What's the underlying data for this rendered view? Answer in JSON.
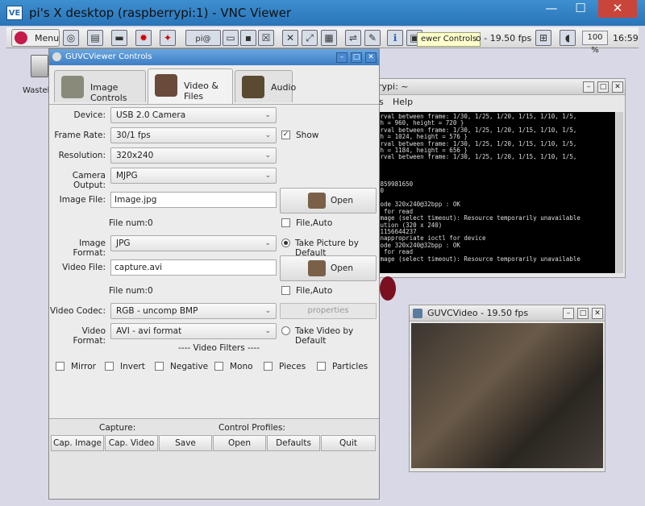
{
  "window": {
    "title": "pi's X desktop (raspberrypi:1) - VNC Viewer",
    "minimize": "—",
    "maximize": "☐",
    "close": "✕"
  },
  "panel": {
    "menu_label": "Menu",
    "tooltip": "ewer Controls",
    "fps_text": "o - 19.50 fps",
    "zoom": "100 %",
    "clock": "16:59",
    "task_label": "pi@"
  },
  "desktop": {
    "trash_label": "Wasteb"
  },
  "terminal": {
    "title": "rypi: ~",
    "menu": [
      "bs",
      "Help"
    ],
    "lines": [
      "erval between frame: 1/30, 1/25, 1/20, 1/15, 1/10, 1/5,",
      "th = 960, height = 720 }",
      "erval between frame: 1/30, 1/25, 1/20, 1/15, 1/10, 1/5,",
      "th = 1024, height = 576 }",
      "erval between frame: 1/30, 1/25, 1/20, 1/15, 1/10, 1/5,",
      "th = 1184, height = 656 }",
      "erval between frame: 1/30, 1/25, 1/20, 1/15, 1/10, 1/5,",
      "",
      "",
      "",
      " 859981650",
      "30",
      "",
      "node 320x240@32bpp : OK",
      "e for read",
      "image (select timeout): Resource temporarily unavailable",
      "lution (320 x 240)",
      " 1156644237",
      "inappropriate ioctl for device",
      "node 320x240@32bpp : OK",
      "e for read",
      "image (select timeout): Resource temporarily unavailable"
    ]
  },
  "video_window": {
    "title": "GUVCVideo - 19.50 fps"
  },
  "controls": {
    "title": "GUVCViewer Controls",
    "tabs": [
      "Image Controls",
      "Video & Files",
      "Audio"
    ],
    "device": {
      "label": "Device:",
      "value": "USB 2.0 Camera"
    },
    "frame_rate": {
      "label": "Frame Rate:",
      "value": "30/1 fps"
    },
    "show_label": "Show",
    "resolution": {
      "label": "Resolution:",
      "value": "320x240"
    },
    "camera_output": {
      "label": "Camera Output:",
      "value": "MJPG"
    },
    "image_file": {
      "label": "Image File:",
      "value": "Image.jpg",
      "open": "Open"
    },
    "image_file_num": "File num:0",
    "image_file_auto": "File,Auto",
    "image_format": {
      "label": "Image Format:",
      "value": "JPG"
    },
    "take_picture_default": "Take Picture by Default",
    "video_file": {
      "label": "Video File:",
      "value": "capture.avi",
      "open": "Open"
    },
    "video_file_num": "File num:0",
    "video_file_auto": "File,Auto",
    "video_codec": {
      "label": "Video Codec:",
      "value": "RGB - uncomp BMP"
    },
    "properties": "properties",
    "video_format": {
      "label": "Video Format:",
      "value": "AVI - avi format"
    },
    "take_video_default": "Take Video by Default",
    "video_filters_heading": "---- Video Filters ----",
    "filters": [
      "Mirror",
      "Invert",
      "Negative",
      "Mono",
      "Pieces",
      "Particles"
    ],
    "capture_label": "Capture:",
    "profiles_label": "Control Profiles:",
    "buttons": {
      "cap_image": "Cap. Image",
      "cap_video": "Cap. Video",
      "save": "Save",
      "open": "Open",
      "defaults": "Defaults",
      "quit": "Quit"
    }
  }
}
